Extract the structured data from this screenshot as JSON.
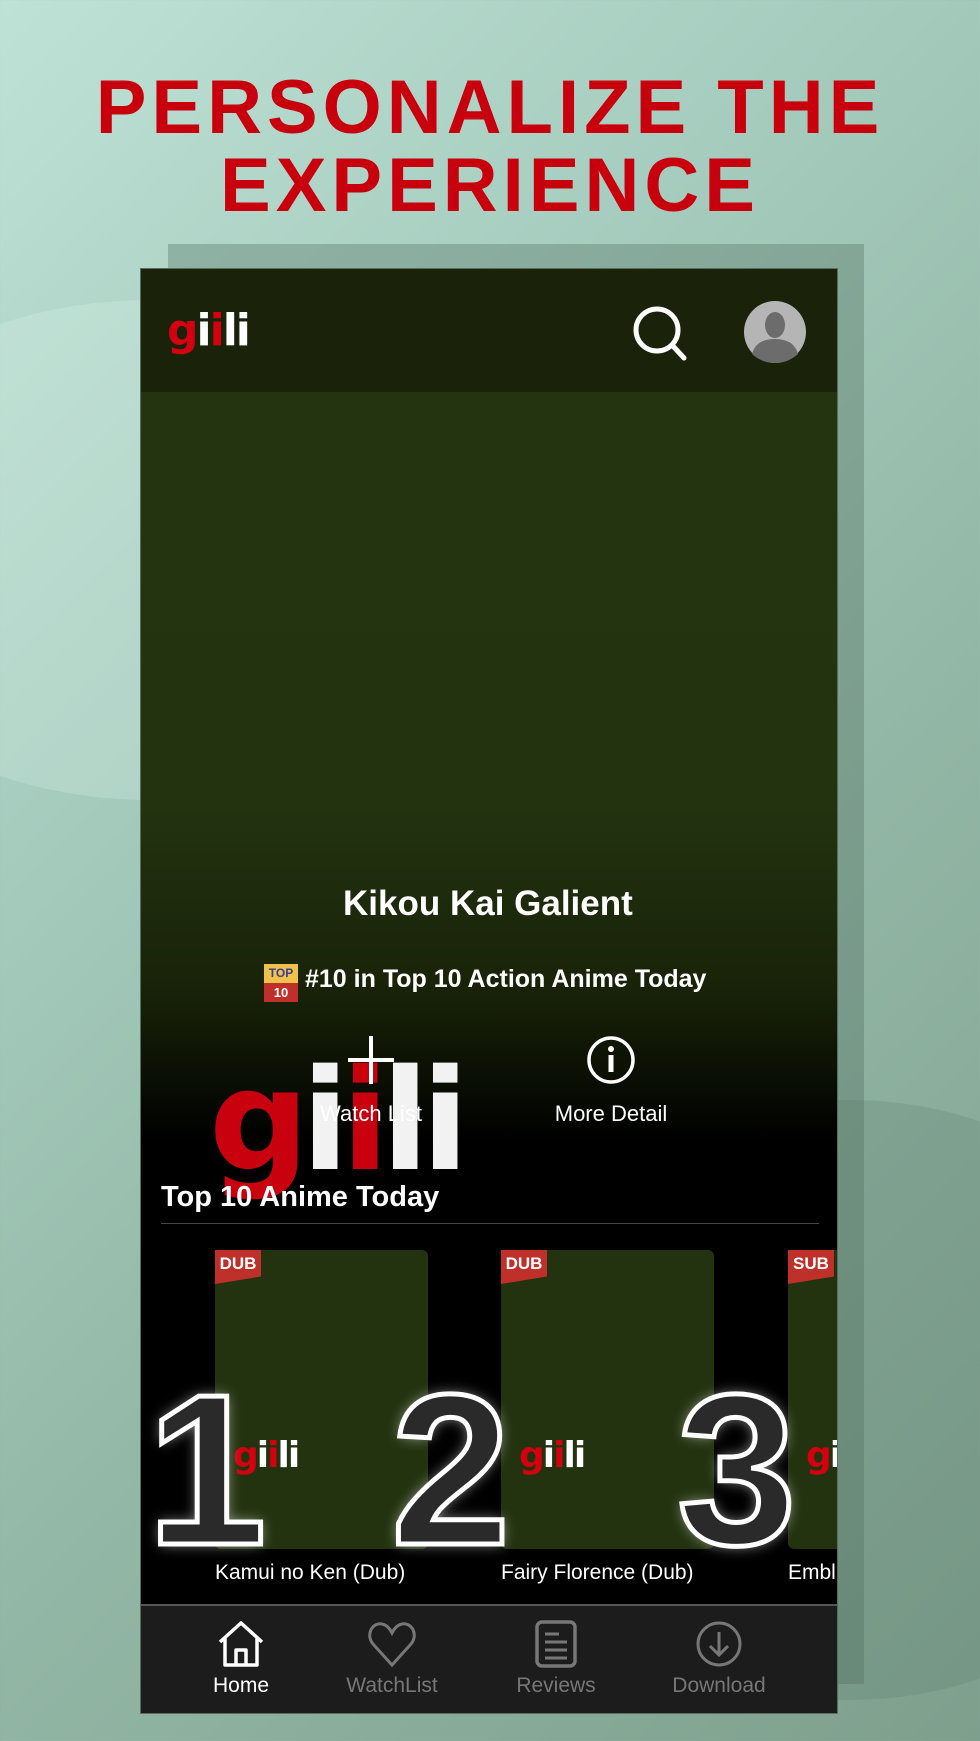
{
  "headline": {
    "line1": "PERSONALIZE THE",
    "line2": "EXPERIENCE",
    "color": "#c8000e"
  },
  "app": {
    "logo": {
      "g": "g",
      "i1": "i",
      "i2": "i",
      "l": "l",
      "i3": "i"
    },
    "header": {
      "search_icon": "search-icon",
      "avatar_icon": "avatar-icon"
    },
    "hero": {
      "title": "Kikou Kai Galient",
      "rank_badge_top": "TOP",
      "rank_badge_bottom": "10",
      "rank_text": "#10 in Top 10 Action Anime Today",
      "actions": [
        {
          "label": "Watch List",
          "icon": "plus-icon"
        },
        {
          "label": "More Detail",
          "icon": "info-icon"
        }
      ]
    },
    "section": {
      "title": "Top 10 Anime Today",
      "items": [
        {
          "rank": "1",
          "badge": "DUB",
          "title": "Kamui no Ken (Dub)"
        },
        {
          "rank": "2",
          "badge": "DUB",
          "title": "Fairy Florence (Dub)"
        },
        {
          "rank": "3",
          "badge": "SUB",
          "title": "Embl"
        }
      ]
    },
    "nav": [
      {
        "label": "Home",
        "icon": "home-icon",
        "active": true
      },
      {
        "label": "WatchList",
        "icon": "heart-icon"
      },
      {
        "label": "Reviews",
        "icon": "reviews-icon"
      },
      {
        "label": "Download",
        "icon": "download-icon"
      }
    ]
  }
}
